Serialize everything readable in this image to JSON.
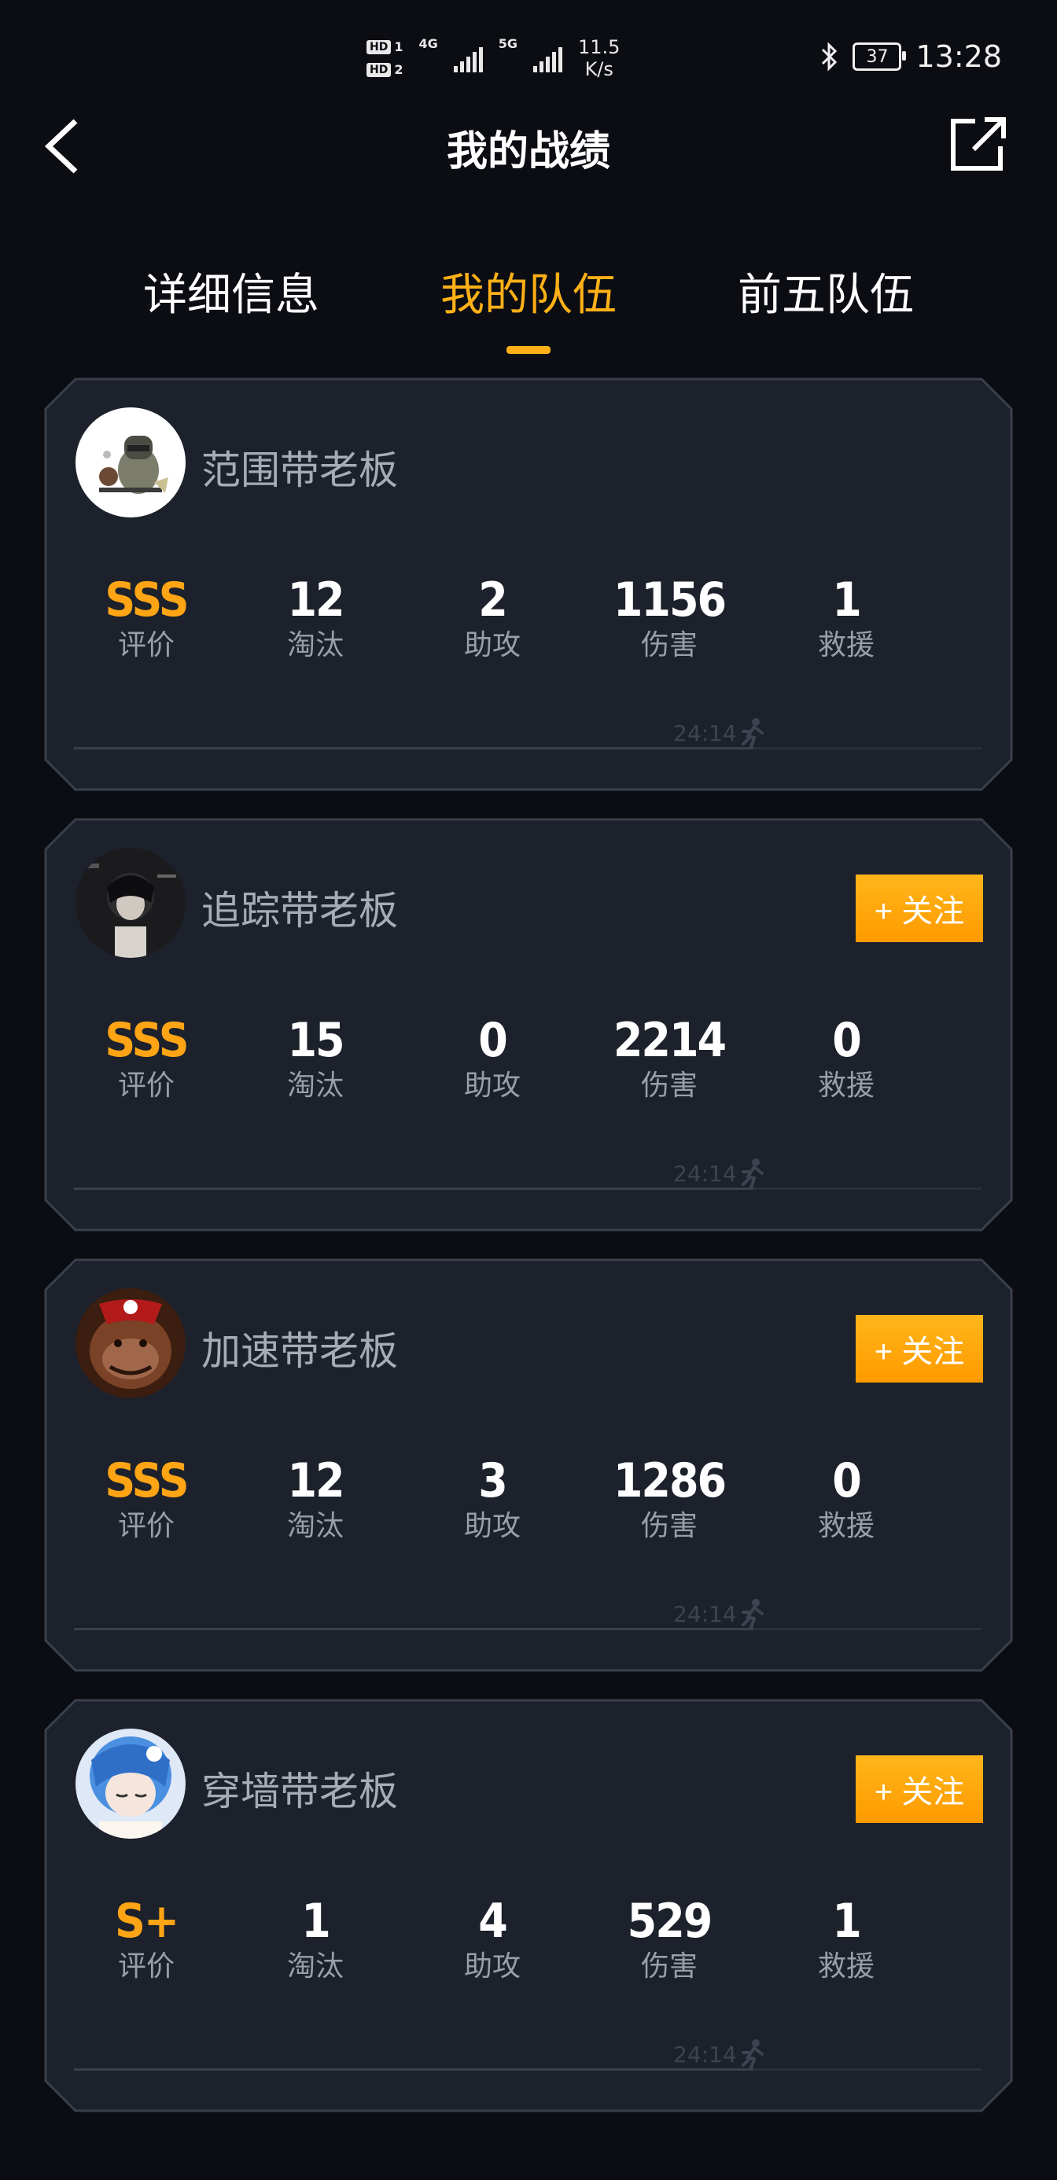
{
  "status_bar": {
    "hd1": "HD",
    "hd1_num": "1",
    "hd2": "HD",
    "hd2_num": "2",
    "net1": "4G",
    "net2": "5G",
    "speed_value": "11.5",
    "speed_unit": "K/s",
    "battery": "37",
    "time": "13:28"
  },
  "header": {
    "title": "我的战绩",
    "back_icon": "back-arrow-icon",
    "share_icon": "share-icon"
  },
  "tabs": [
    {
      "label": "详细信息",
      "active": false
    },
    {
      "label": "我的队伍",
      "active": true
    },
    {
      "label": "前五队伍",
      "active": false
    }
  ],
  "stat_labels": {
    "rating": "评价",
    "kills": "淘汰",
    "assists": "助攻",
    "damage": "伤害",
    "rescues": "救援"
  },
  "follow_label": "+ 关注",
  "players": [
    {
      "name": "范围带老板",
      "rating": "SSS",
      "kills": "12",
      "assists": "2",
      "damage": "1156",
      "rescues": "1",
      "time": "24:14",
      "show_follow": false,
      "avatar": "soldier-avatar"
    },
    {
      "name": "追踪带老板",
      "rating": "SSS",
      "kills": "15",
      "assists": "0",
      "damage": "2214",
      "rescues": "0",
      "time": "24:14",
      "show_follow": true,
      "avatar": "anime-dark-avatar"
    },
    {
      "name": "加速带老板",
      "rating": "SSS",
      "kills": "12",
      "assists": "3",
      "damage": "1286",
      "rescues": "0",
      "time": "24:14",
      "show_follow": true,
      "avatar": "orangutan-avatar"
    },
    {
      "name": "穿墙带老板",
      "rating": "S+",
      "kills": "1",
      "assists": "4",
      "damage": "529",
      "rescues": "1",
      "time": "24:14",
      "show_follow": true,
      "avatar": "anime-blue-hair-avatar"
    }
  ],
  "colors": {
    "accent": "#ffb017",
    "rating": "#ffa515",
    "card_bg": "#1c212b",
    "card_border": "#3a404b",
    "page_bg": "#0b0d12"
  }
}
